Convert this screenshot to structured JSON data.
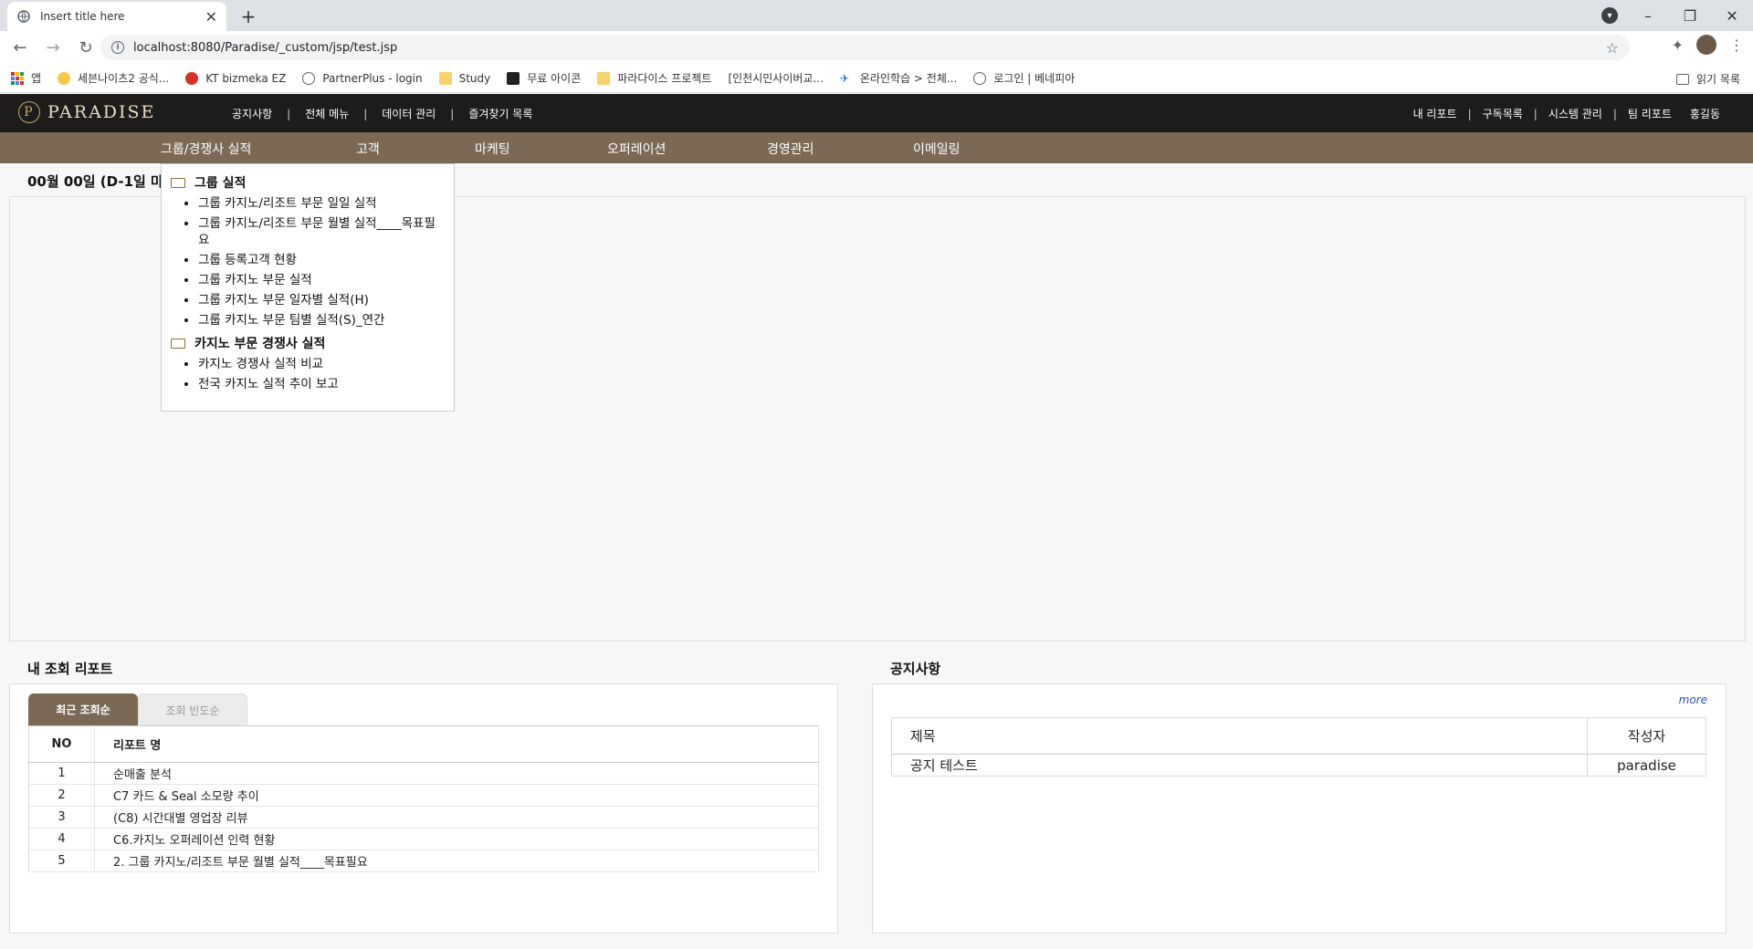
{
  "browser": {
    "tab_title": "Insert title here",
    "url": "localhost:8080/Paradise/_custom/jsp/test.jsp",
    "bookmarks": [
      "앱",
      "세븐나이츠2 공식...",
      "KT bizmeka EZ",
      "PartnerPlus - login",
      "Study",
      "무료 아이콘",
      "파라다이스 프로젝트",
      "[인천시민사이버교...",
      "온라인학습 > 전체...",
      "로그인 | 베네피아"
    ],
    "reading_list": "읽기 목록"
  },
  "header": {
    "logo_text": "PARADISE",
    "top_menu": [
      "공지사항",
      "전체 메뉴",
      "데이터 관리",
      "즐겨찾기 목록"
    ],
    "util_menu": [
      "내 리포트",
      "구독목록",
      "시스템 관리",
      "팀 리포트",
      "홍길동"
    ]
  },
  "main_nav": [
    "그룹/경쟁사 실적",
    "고객",
    "마케팅",
    "오퍼레이션",
    "경영관리",
    "이메일링"
  ],
  "dropdown": {
    "groups": [
      {
        "title": "그룹 실적",
        "items": [
          "그룹 카지노/리조트 부문 일일 실적",
          "그룹 카지노/리조트 부문 월별 실적____목표필요",
          "그룹 등록고객 현황",
          "그룹 카지노 부문 실적",
          "그룹 카지노 부문 일자별 실적(H)",
          "그룹 카지노 부문 팀별 실적(S)_연간"
        ]
      },
      {
        "title": "카지노 부문 경쟁사 실적",
        "items": [
          "카지노 경쟁사 실적 비교",
          "전국 카지노 실적 추이 보고"
        ]
      }
    ]
  },
  "hero": {
    "title": "00월 00일 (D-1일 마"
  },
  "my_reports": {
    "title": "내 조회 리포트",
    "tabs": [
      "최근 조회순",
      "조회 빈도순"
    ],
    "columns": [
      "NO",
      "리포트 명"
    ],
    "rows": [
      {
        "no": "1",
        "name": "순매출 분석"
      },
      {
        "no": "2",
        "name": "C7 카드 & Seal 소모량 추이"
      },
      {
        "no": "3",
        "name": "(C8) 시간대별 영업장 리뷰"
      },
      {
        "no": "4",
        "name": "C6.카지노 오퍼레이션 인력 현황"
      },
      {
        "no": "5",
        "name": "2. 그룹 카지노/리조트 부문 월별 실적____목표필요"
      }
    ]
  },
  "notices": {
    "title": "공지사항",
    "more": "more",
    "columns": [
      "제목",
      "작성자"
    ],
    "rows": [
      {
        "title": "공지 테스트",
        "writer": "paradise"
      }
    ]
  }
}
